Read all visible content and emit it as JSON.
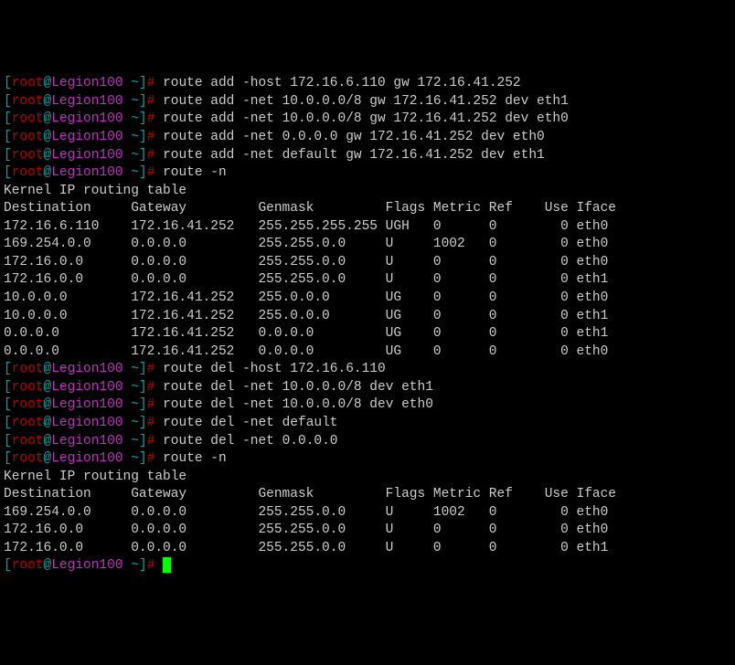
{
  "prompt": {
    "open": "[",
    "user": "root",
    "at": "@",
    "host": "Legion100",
    "path": " ~",
    "close": "]",
    "hash": "# "
  },
  "cmd1": "route add -host 172.16.6.110 gw 172.16.41.252",
  "cmd2": "route add -net 10.0.0.0/8 gw 172.16.41.252 dev eth1",
  "cmd3": "route add -net 10.0.0.0/8 gw 172.16.41.252 dev eth0",
  "cmd4": "route add -net 0.0.0.0 gw 172.16.41.252 dev eth0",
  "cmd5": "route add -net default gw 172.16.41.252 dev eth1",
  "cmd6": "route -n",
  "table1_title": "Kernel IP routing table",
  "hdr": "Destination     Gateway         Genmask         Flags Metric Ref    Use Iface",
  "t1r1": "172.16.6.110    172.16.41.252   255.255.255.255 UGH   0      0        0 eth0",
  "t1r2": "169.254.0.0     0.0.0.0         255.255.0.0     U     1002   0        0 eth0",
  "t1r3": "172.16.0.0      0.0.0.0         255.255.0.0     U     0      0        0 eth0",
  "t1r4": "172.16.0.0      0.0.0.0         255.255.0.0     U     0      0        0 eth1",
  "t1r5": "10.0.0.0        172.16.41.252   255.0.0.0       UG    0      0        0 eth0",
  "t1r6": "10.0.0.0        172.16.41.252   255.0.0.0       UG    0      0        0 eth1",
  "t1r7": "0.0.0.0         172.16.41.252   0.0.0.0         UG    0      0        0 eth1",
  "t1r8": "0.0.0.0         172.16.41.252   0.0.0.0         UG    0      0        0 eth0",
  "cmd7": "route del -host 172.16.6.110",
  "cmd8": "route del -net 10.0.0.0/8 dev eth1",
  "cmd9": "route del -net 10.0.0.0/8 dev eth0",
  "cmd10": "route del -net default",
  "cmd11": "route del -net 0.0.0.0",
  "cmd12": "route -n",
  "table2_title": "Kernel IP routing table",
  "t2r1": "169.254.0.0     0.0.0.0         255.255.0.0     U     1002   0        0 eth0",
  "t2r2": "172.16.0.0      0.0.0.0         255.255.0.0     U     0      0        0 eth0",
  "t2r3": "172.16.0.0      0.0.0.0         255.255.0.0     U     0      0        0 eth1"
}
